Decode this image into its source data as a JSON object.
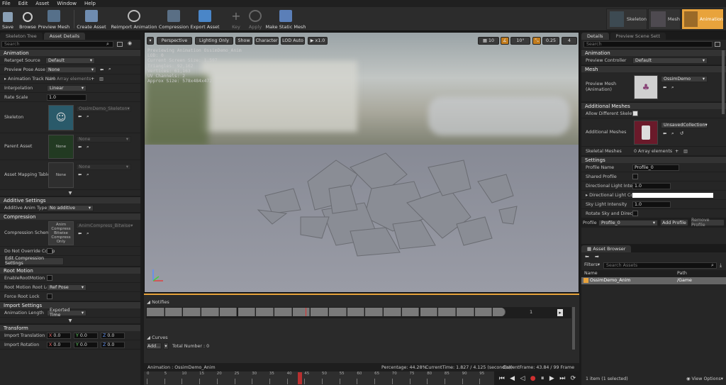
{
  "menu": [
    "File",
    "Edit",
    "Asset",
    "Window",
    "Help"
  ],
  "toolbar": {
    "save": "Save",
    "browse": "Browse",
    "preview_mesh": "Preview Mesh",
    "create_asset": "Create Asset",
    "reimport": "Reimport Animation",
    "compression": "Compression",
    "export": "Export Asset",
    "key": "Key",
    "apply": "Apply",
    "make_static": "Make Static Mesh",
    "mode_skeleton": "Skeleton",
    "mode_mesh": "Mesh",
    "mode_animation": "Animation"
  },
  "left": {
    "tab1": "Skeleton Tree",
    "tab2": "Asset Details",
    "search": "Search",
    "sec_animation": "Animation",
    "retarget_label": "Retarget Source",
    "retarget_value": "Default",
    "preview_pose_label": "Preview Pose Asset",
    "preview_pose_value": "None",
    "track_label": "Animation Track Nam",
    "track_value": "110 Array elements",
    "interp_label": "Interpolation",
    "interp_value": "Linear",
    "rate_label": "Rate Scale",
    "rate_value": "1.0",
    "skeleton_label": "Skeleton",
    "skeleton_value": "OssimDemo_Skeleton",
    "parent_label": "Parent Asset",
    "parent_value": "None",
    "parent_thumb": "None",
    "mapping_label": "Asset Mapping Table",
    "mapping_value": "None",
    "mapping_thumb": "None",
    "sec_additive": "Additive Settings",
    "additive_label": "Additive Anim Type",
    "additive_value": "No additive",
    "sec_compression": "Compression",
    "comp_label": "Compression Scheme",
    "comp_thumb": "Anim Compress Bitwise Compress Only",
    "comp_value": "AnimCompress_Bitwise",
    "dont_override": "Do Not Override Comp",
    "edit_comp": "Edit Compression Settings",
    "sec_root": "Root Motion",
    "enable_root": "EnableRootMotion",
    "root_lock_label": "Root Motion Root Loc",
    "root_lock_value": "Ref Pose",
    "force_root": "Force Root Lock",
    "sec_import": "Import Settings",
    "anim_len_label": "Animation Length",
    "anim_len_value": "Exported Time",
    "sec_transform": "Transform",
    "imp_trans": "Import Translation",
    "imp_rot": "Import Rotation",
    "x": "X",
    "y": "Y",
    "z": "Z",
    "zero": "0.0"
  },
  "viewport": {
    "perspective": "Perspective",
    "lighting": "Lighting Only",
    "show": "Show",
    "character": "Character",
    "lod": "LOD Auto",
    "speed": "x1.0",
    "grid": "10",
    "angle": "10°",
    "scale": "0.25",
    "cams": "4",
    "stats": [
      "Previewing Animation OssimDemo_Anim",
      "LOD: 0",
      "Current Screen Size: 1.597",
      "Triangles: 92,162",
      "Vertices: 61,163",
      "UV Channels: 2",
      "Approx Size: 578x484x472"
    ]
  },
  "notifies": {
    "title": "Notifies",
    "track_num": "1",
    "curves": "Curves",
    "add": "Add...",
    "total": "Total Number : 0"
  },
  "timeline": {
    "anim_name": "Animation : OssimDemo_Anim",
    "percentage": "Percentage: 44.28%",
    "current_time": "CurrentTime: 1.827 / 4.125 (second(s))",
    "current_frame": "CurrentFrame: 43.84 / 99 Frame",
    "ticks": [
      "0",
      "5",
      "10",
      "15",
      "20",
      "25",
      "30",
      "35",
      "40",
      "45",
      "50",
      "55",
      "60",
      "65",
      "70",
      "75",
      "80",
      "85",
      "90",
      "95"
    ]
  },
  "right": {
    "tab1": "Details",
    "tab2": "Preview Scene Sett",
    "search": "Search",
    "sec_animation": "Animation",
    "preview_ctrl_label": "Preview Controller",
    "preview_ctrl_value": "Default",
    "sec_mesh": "Mesh",
    "preview_mesh_label": "Preview Mesh (Animation)",
    "preview_mesh_value": "OssimDemo",
    "sec_add_meshes": "Additional Meshes",
    "allow_diff": "Allow Different Skelet",
    "add_meshes_label": "Additional Meshes",
    "add_meshes_value": "UnsavedCollection",
    "skel_meshes_label": "Skeletal Meshes",
    "skel_meshes_value": "0 Array elements",
    "sec_settings": "Settings",
    "profile_name_label": "Profile Name",
    "profile_name_value": "Profile_0",
    "shared_profile": "Shared Profile",
    "dir_int_label": "Directional Light Inter",
    "dir_int_value": "1.0",
    "dir_col_label": "Directional Light Colo",
    "sky_label": "Sky Light Intensity",
    "sky_value": "1.0",
    "rotate_sky": "Rotate Sky and Direct",
    "profile_label": "Profile",
    "profile_value": "Profile_0",
    "add_profile": "Add Profile",
    "remove_profile": "Remove Profile"
  },
  "browser": {
    "tab": "Asset Browser",
    "filters": "Filters",
    "search": "Search Assets",
    "col_name": "Name",
    "col_path": "Path",
    "item_name": "OssimDemo_Anim",
    "item_path": "/Game",
    "footer": "1 item (1 selected)",
    "view_options": "View Options"
  },
  "colors": {
    "accent": "#e8a33c",
    "sel": "#c27c1d",
    "bg": "#262626"
  }
}
